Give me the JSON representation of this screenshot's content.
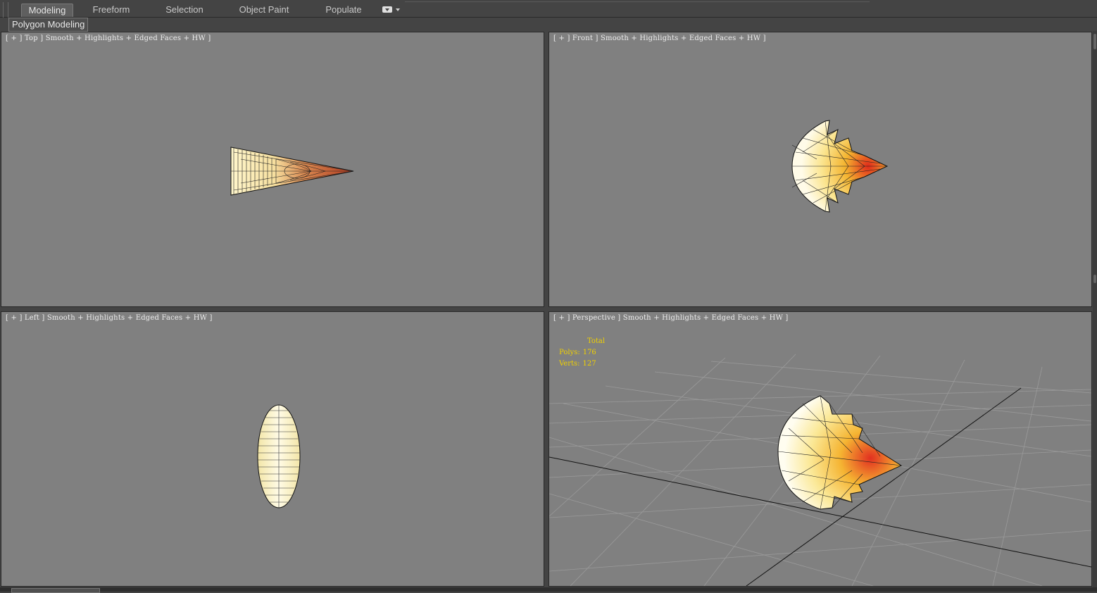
{
  "ribbon": {
    "tabs": [
      {
        "label": "Modeling",
        "active": true
      },
      {
        "label": "Freeform",
        "active": false
      },
      {
        "label": "Selection",
        "active": false
      },
      {
        "label": "Object Paint",
        "active": false
      },
      {
        "label": "Populate",
        "active": false
      }
    ],
    "subtab": "Polygon Modeling"
  },
  "viewports": [
    {
      "name": "top",
      "label": "[ + ] Top ] Smooth + Highlights + Edged Faces + HW ]"
    },
    {
      "name": "front",
      "label": "[ + ] Front ] Smooth + Highlights + Edged Faces + HW ]"
    },
    {
      "name": "left",
      "label": "[ + ] Left ] Smooth + Highlights + Edged Faces + HW ]"
    },
    {
      "name": "perspective",
      "label": "[ + ] Perspective ] Smooth + Highlights + Edged Faces + HW ]"
    }
  ],
  "stats": {
    "title": "Total",
    "polys_label": "Polys:",
    "polys_value": "176",
    "verts_label": "Verts:",
    "verts_value": "127"
  },
  "colors": {
    "viewport_bg": "#808080",
    "ui_bg": "#444444",
    "stats_text": "#f0d000",
    "mesh_light": "#fff4c0",
    "mesh_mid": "#f5c040",
    "mesh_hot": "#e03020"
  }
}
